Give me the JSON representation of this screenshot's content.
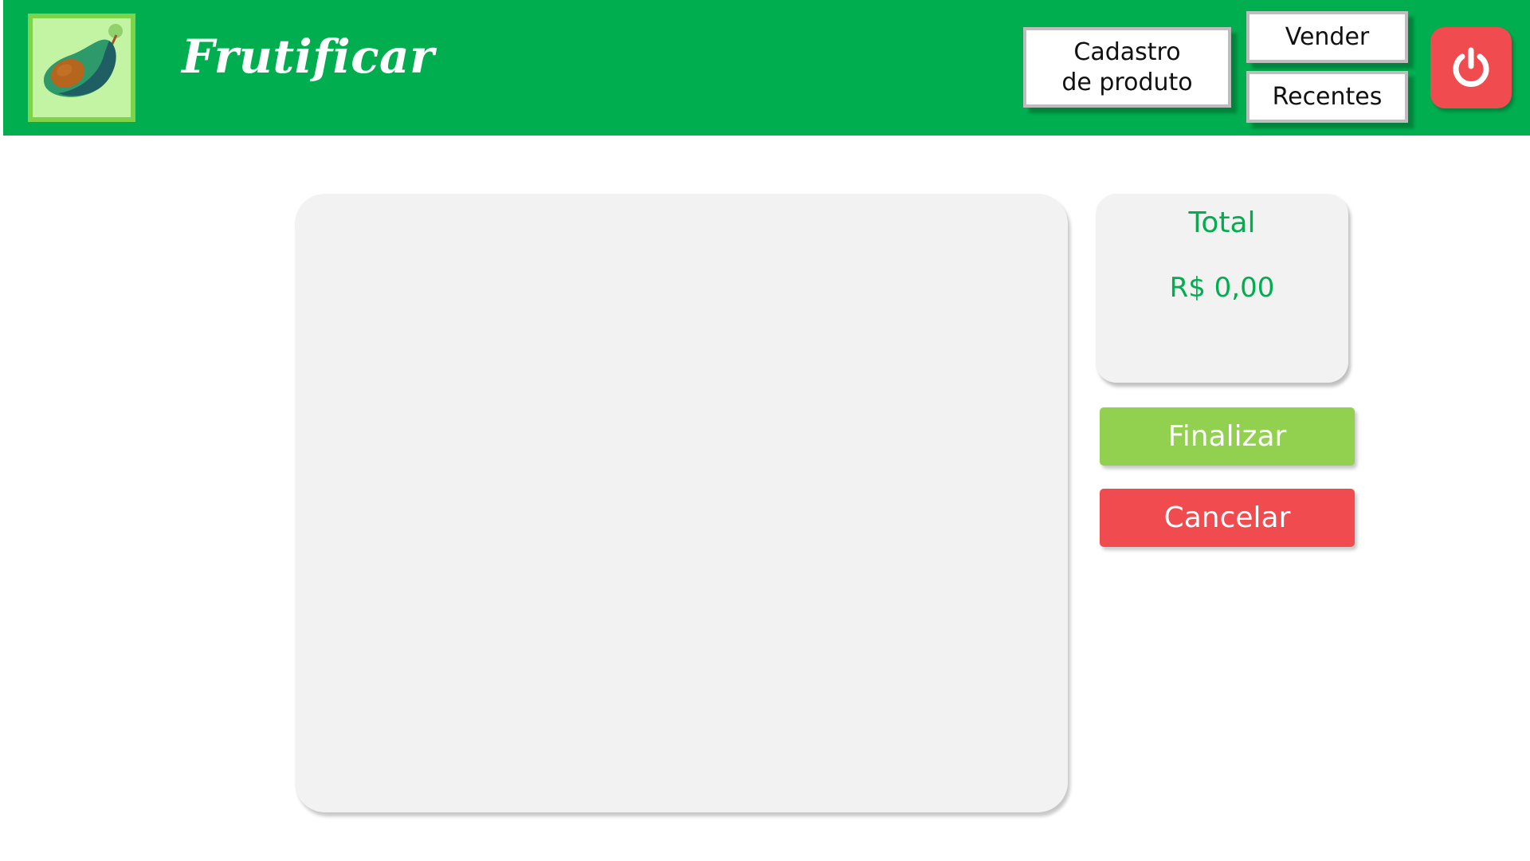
{
  "header": {
    "brand": "Frutificar",
    "background_color": "#00ae4f",
    "logo_icon": "avocado-icon"
  },
  "nav": {
    "cadastro_label": "Cadastro de produto",
    "vender_label": "Vender",
    "recentes_label": "Recentes",
    "power_icon": "power-icon",
    "power_color": "#f04b4f"
  },
  "sale": {
    "total_label": "Total",
    "total_value": "R$ 0,00",
    "finalizar_label": "Finalizar",
    "cancelar_label": "Cancelar",
    "accent_color": "#00ae4f",
    "finalizar_color": "#92d050",
    "cancelar_color": "#f04b4f"
  }
}
